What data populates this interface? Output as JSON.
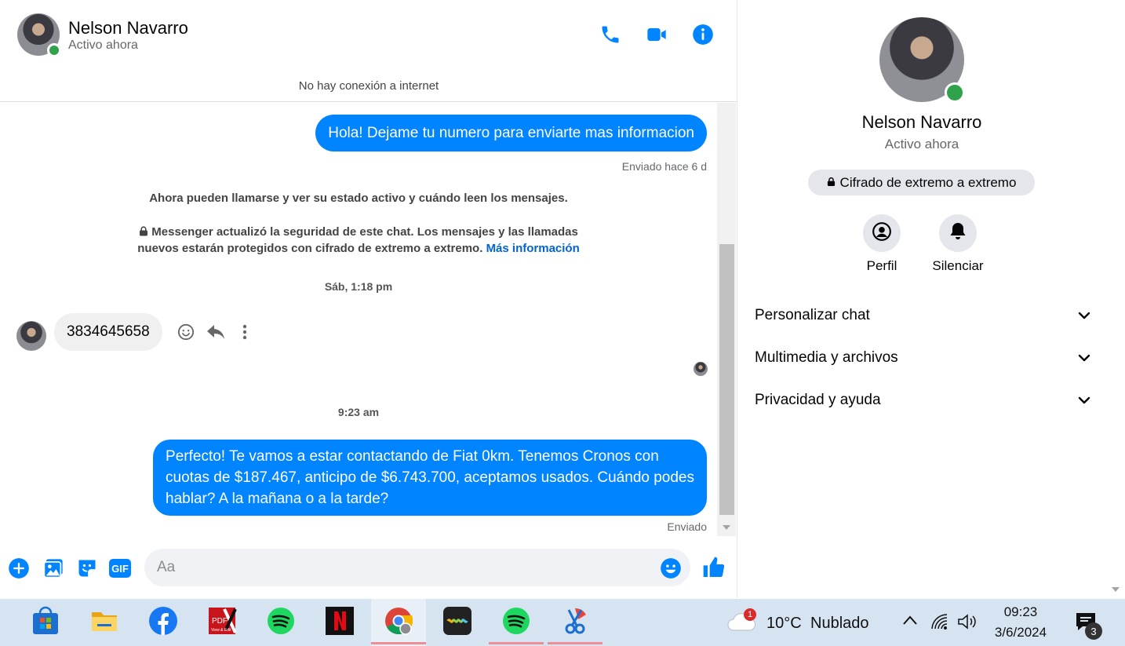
{
  "contact": {
    "name": "Nelson Navarro",
    "status": "Activo ahora"
  },
  "header": {
    "connection_notice": "No hay conexión a internet",
    "icons": [
      "phone-icon",
      "video-call-icon",
      "info-icon"
    ]
  },
  "messages": {
    "outgoing_1": "Hola! Dejame tu numero para enviarte mas informacion",
    "outgoing_1_meta": "Enviado hace 6 d",
    "system_1": "Ahora pueden llamarse y ver su estado activo y cuándo leen los mensajes.",
    "system_2_line1": "Messenger actualizó la seguridad de este chat. Los mensajes y las llamadas",
    "system_2_line2": "nuevos estarán protegidos con cifrado de extremo a extremo.",
    "system_2_link": "Más información",
    "timestamp_1": "Sáb, 1:18 pm",
    "incoming_1": "3834645658",
    "timestamp_2": "9:23 am",
    "outgoing_2_line1": "Perfecto! Te vamos a estar contactando de Fiat 0km. Tenemos Cronos con",
    "outgoing_2_line2": "cuotas de $187.467, anticipo de $6.743.700, aceptamos usados. Cuándo podes",
    "outgoing_2_line3": "hablar? A la mañana o a la tarde?",
    "outgoing_2_meta": "Enviado"
  },
  "composer": {
    "placeholder": "Aa"
  },
  "info_panel": {
    "encryption_label": "Cifrado de extremo a extremo",
    "actions": [
      {
        "label": "Perfil",
        "icon": "profile-icon"
      },
      {
        "label": "Silenciar",
        "icon": "bell-icon"
      }
    ],
    "sections": [
      {
        "label": "Personalizar chat"
      },
      {
        "label": "Multimedia y archivos"
      },
      {
        "label": "Privacidad y ayuda"
      }
    ]
  },
  "taskbar": {
    "weather_temp": "10°C",
    "weather_desc": "Nublado",
    "weather_badge": "1",
    "time": "09:23",
    "date": "3/6/2024",
    "notification_count": "3",
    "pdf_icon_text": "PDF",
    "pdf_icon_subtext": "View & Edit",
    "gif_label": "GIF"
  },
  "colors": {
    "accent": "#0084ff",
    "online": "#31a24c",
    "link": "#0064d1",
    "taskbar": "#d6e4f2"
  }
}
